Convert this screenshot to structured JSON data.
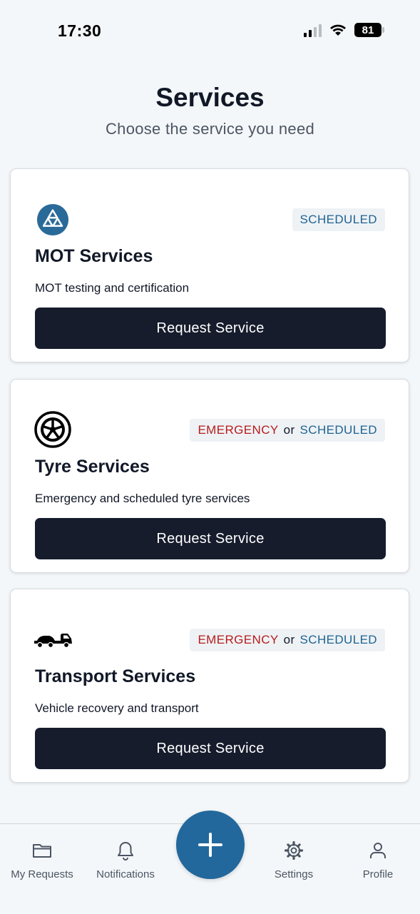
{
  "status_bar": {
    "time": "17:30",
    "battery": "81"
  },
  "header": {
    "title": "Services",
    "subtitle": "Choose the service you need"
  },
  "services": [
    {
      "icon": "mot-triangles-icon",
      "title": "MOT Services",
      "description": "MOT testing and certification",
      "badge": {
        "emergency": "",
        "or": "",
        "scheduled": "SCHEDULED"
      },
      "button_label": "Request Service"
    },
    {
      "icon": "tyre-icon",
      "title": "Tyre Services",
      "description": "Emergency and scheduled tyre services",
      "badge": {
        "emergency": "EMERGENCY",
        "or": "or",
        "scheduled": "SCHEDULED"
      },
      "button_label": "Request Service"
    },
    {
      "icon": "tow-truck-icon",
      "title": "Transport Services",
      "description": "Vehicle recovery and transport",
      "badge": {
        "emergency": "EMERGENCY",
        "or": "or",
        "scheduled": "SCHEDULED"
      },
      "button_label": "Request Service"
    }
  ],
  "bottom_nav": {
    "items": [
      {
        "label": "My Requests",
        "icon": "folder-icon"
      },
      {
        "label": "Notifications",
        "icon": "bell-icon"
      },
      {
        "label": "Settings",
        "icon": "gear-icon"
      },
      {
        "label": "Profile",
        "icon": "user-icon"
      }
    ],
    "fab_icon": "plus-icon"
  },
  "colors": {
    "accent": "#22689c",
    "button": "#161c2c",
    "scheduled": "#1f6391",
    "emergency": "#b71c1c",
    "background": "#f4f7f9"
  }
}
